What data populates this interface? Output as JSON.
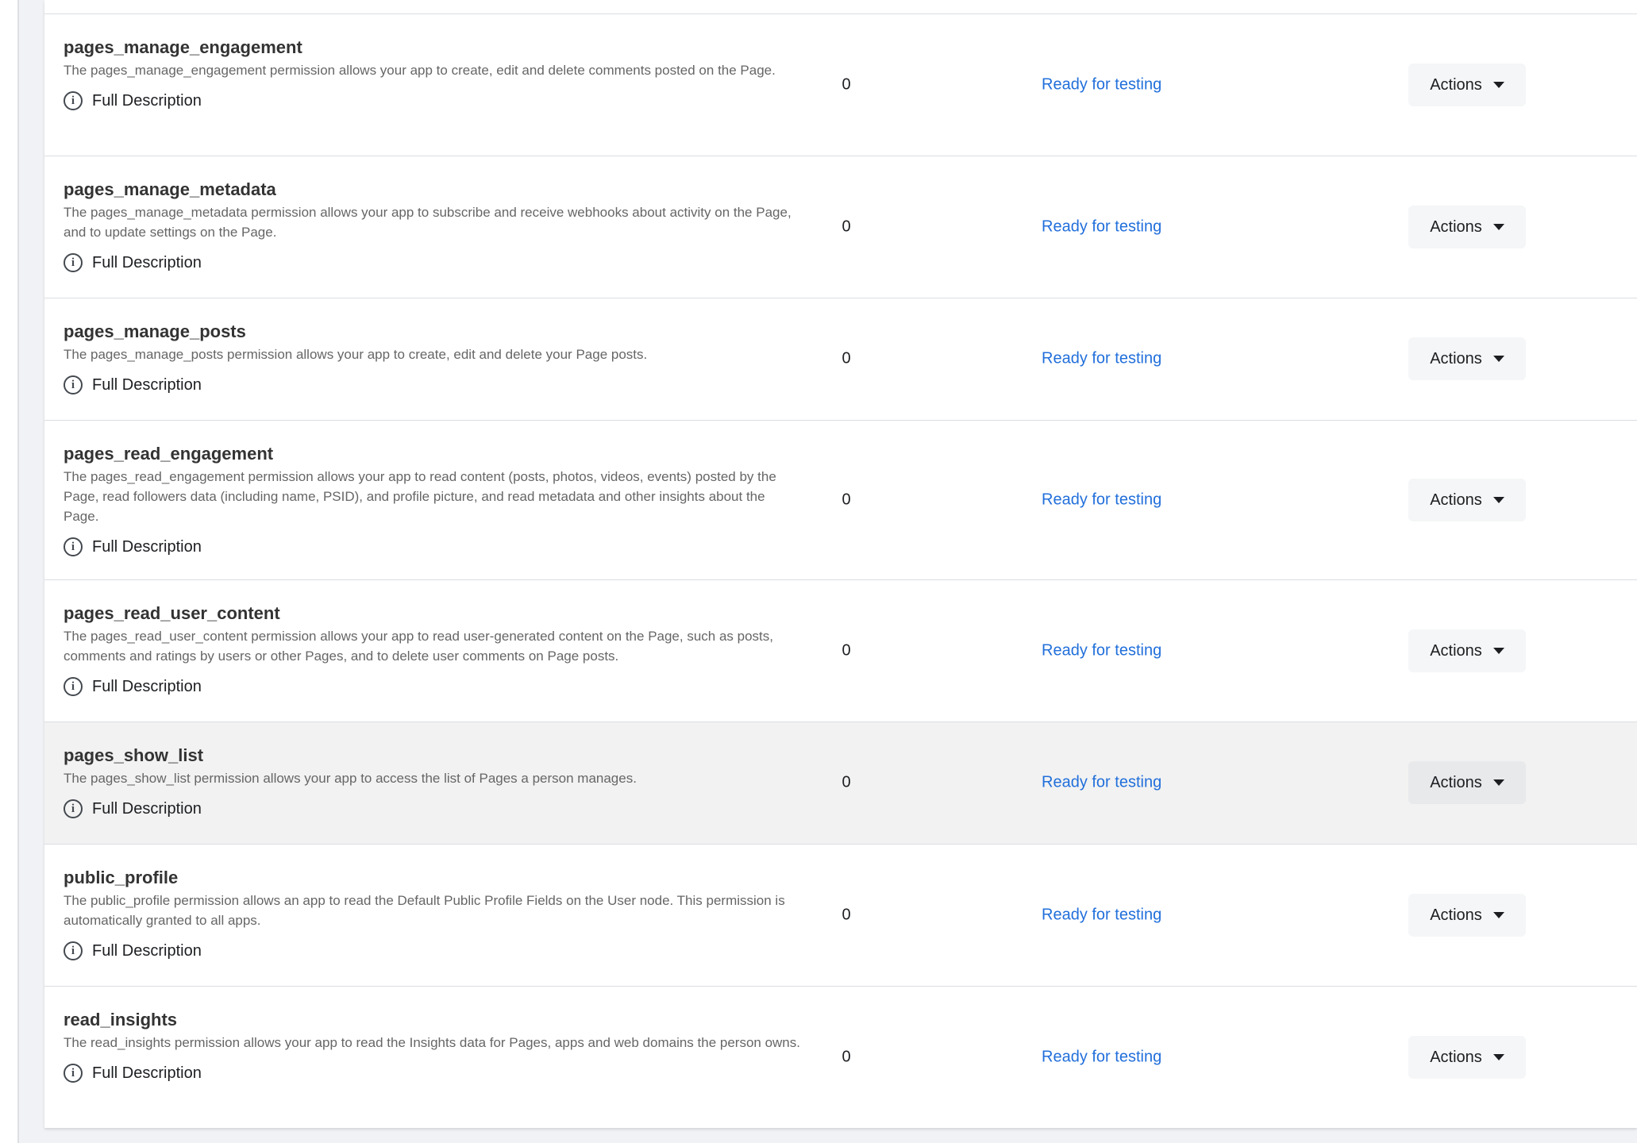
{
  "permissions": [
    {
      "name": "pages_manage_engagement",
      "description": "The pages_manage_engagement permission allows your app to create, edit and delete comments posted on the Page.",
      "full_description_label": "Full Description",
      "count": "0",
      "status": "Ready for testing",
      "actions_label": "Actions"
    },
    {
      "name": "pages_manage_metadata",
      "description": "The pages_manage_metadata permission allows your app to subscribe and receive webhooks about activity on the Page, and to update settings on the Page.",
      "full_description_label": "Full Description",
      "count": "0",
      "status": "Ready for testing",
      "actions_label": "Actions"
    },
    {
      "name": "pages_manage_posts",
      "description": "The pages_manage_posts permission allows your app to create, edit and delete your Page posts.",
      "full_description_label": "Full Description",
      "count": "0",
      "status": "Ready for testing",
      "actions_label": "Actions"
    },
    {
      "name": "pages_read_engagement",
      "description": "The pages_read_engagement permission allows your app to read content (posts, photos, videos, events) posted by the Page, read followers data (including name, PSID), and profile picture, and read metadata and other insights about the Page.",
      "full_description_label": "Full Description",
      "count": "0",
      "status": "Ready for testing",
      "actions_label": "Actions"
    },
    {
      "name": "pages_read_user_content",
      "description": "The pages_read_user_content permission allows your app to read user-generated content on the Page, such as posts, comments and ratings by users or other Pages, and to delete user comments on Page posts.",
      "full_description_label": "Full Description",
      "count": "0",
      "status": "Ready for testing",
      "actions_label": "Actions"
    },
    {
      "name": "pages_show_list",
      "description": "The pages_show_list permission allows your app to access the list of Pages a person manages.",
      "full_description_label": "Full Description",
      "count": "0",
      "status": "Ready for testing",
      "actions_label": "Actions"
    },
    {
      "name": "public_profile",
      "description": "The public_profile permission allows an app to read the Default Public Profile Fields on the User node. This permission is automatically granted to all apps.",
      "full_description_label": "Full Description",
      "count": "0",
      "status": "Ready for testing",
      "actions_label": "Actions"
    },
    {
      "name": "read_insights",
      "description": "The read_insights permission allows your app to read the Insights data for Pages, apps and web domains the person owns.",
      "full_description_label": "Full Description",
      "count": "0",
      "status": "Ready for testing",
      "actions_label": "Actions"
    }
  ],
  "icons": {
    "info": "info-circle-icon",
    "dropdown": "caret-down-icon"
  },
  "colors": {
    "link": "#216fdb",
    "hover_row": "#f2f2f2",
    "button_bg": "#f5f6f7"
  }
}
